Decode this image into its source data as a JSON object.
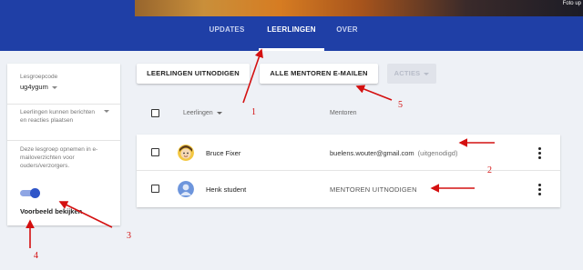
{
  "banner": {
    "photo_link": "Foto up"
  },
  "nav": {
    "tabs": [
      {
        "label": "UPDATES"
      },
      {
        "label": "LEERLINGEN"
      },
      {
        "label": "OVER"
      }
    ],
    "active_tab": "LEERLINGEN"
  },
  "sidebar": {
    "class_code_label": "Lesgroepcode",
    "class_code_value": "ug4ygum",
    "post_permission": "Leerlingen kunnen berichten en reacties plaatsen",
    "guardian_summary_label": "Deze lesgroep opnemen in e-mailoverzichten voor ouders/verzorgers.",
    "guardian_summary_enabled": true,
    "preview_link": "Voorbeeld bekijken"
  },
  "toolbar": {
    "invite_students": "LEERLINGEN UITNODIGEN",
    "email_all_mentors": "ALLE MENTOREN E-MAILEN",
    "actions": "ACTIES"
  },
  "list_header": {
    "students_col": "Leerlingen",
    "mentors_col": "Mentoren"
  },
  "students": [
    {
      "name": "Bruce Fixer",
      "mentor_email": "buelens.wouter@gmail.com",
      "mentor_status": "(uitgenodigd)"
    },
    {
      "name": "Henk student",
      "invite_mentors": "MENTOREN UITNODIGEN"
    }
  ],
  "annotations": {
    "numbers": [
      "1",
      "2",
      "3",
      "4",
      "5"
    ],
    "color": "#d41010"
  },
  "colors": {
    "nav_bg": "#1f3fa6",
    "page_bg": "#eef1f6",
    "toggle_on": "#2f55c8"
  }
}
